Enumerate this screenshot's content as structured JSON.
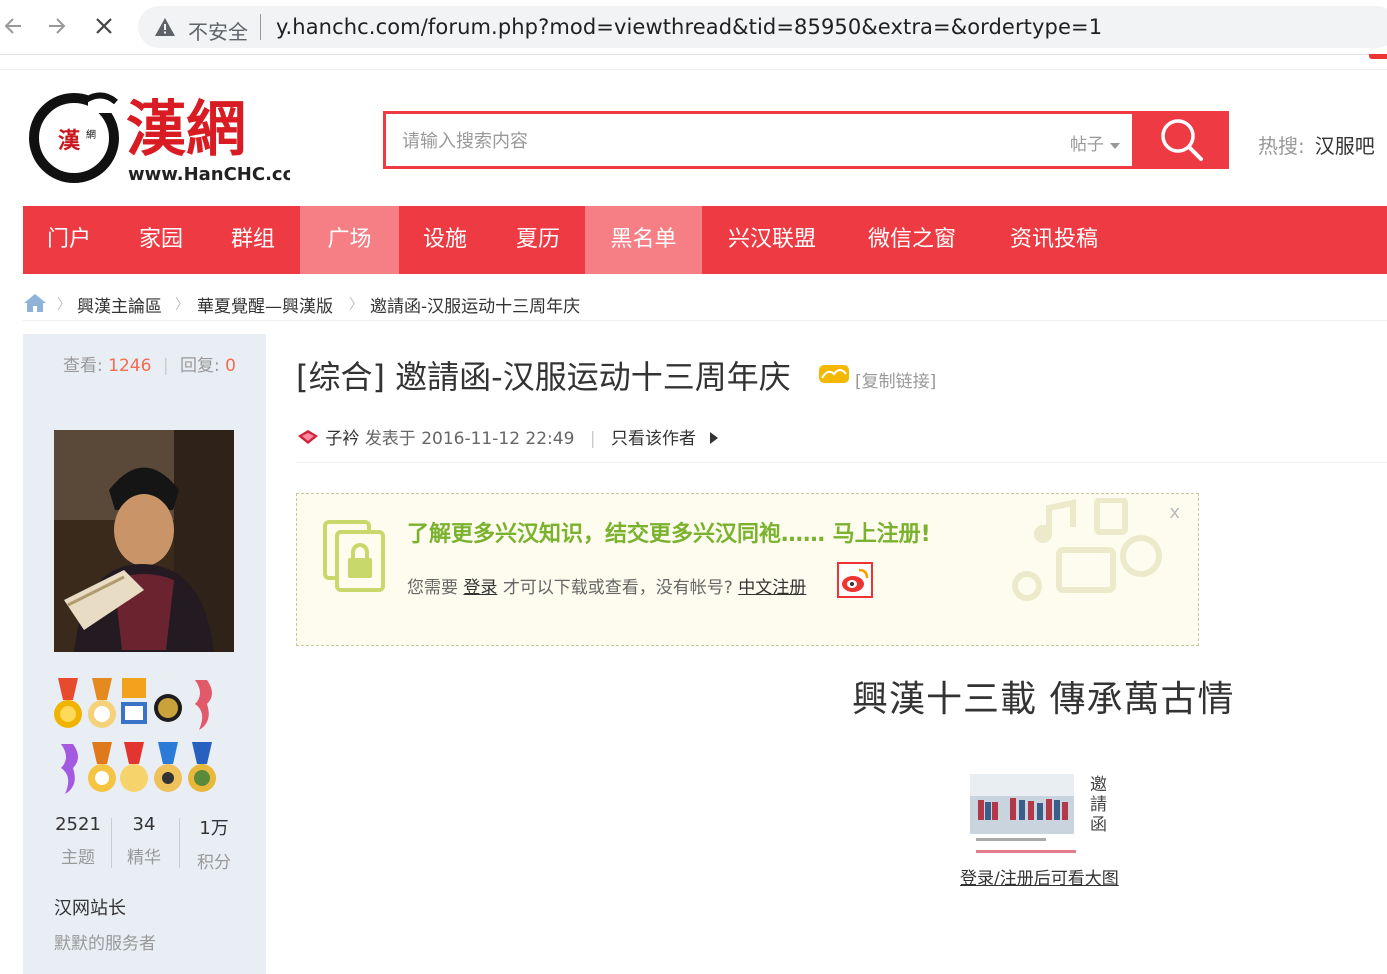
{
  "browser": {
    "insecure_label": "不安全",
    "url": "y.hanchc.com/forum.php?mod=viewthread&tid=85950&extra=&ordertype=1"
  },
  "header": {
    "logo_text_cn": "漢網",
    "logo_text_en": "www.HanCHC.com",
    "search_placeholder": "请输入搜索内容",
    "search_type": "帖子",
    "hot_label": "热搜:",
    "hot_keyword": "汉服吧"
  },
  "nav": [
    {
      "label": "门户"
    },
    {
      "label": "家园"
    },
    {
      "label": "群组"
    },
    {
      "label": "广场"
    },
    {
      "label": "设施"
    },
    {
      "label": "夏历"
    },
    {
      "label": "黑名单"
    },
    {
      "label": "兴汉联盟"
    },
    {
      "label": "微信之窗"
    },
    {
      "label": "资讯投稿"
    }
  ],
  "breadcrumb": [
    "興漢主論區",
    "華夏覺醒—興漢版",
    "邀請函-汉服运动十三周年庆"
  ],
  "sidebar": {
    "views_label": "查看:",
    "views": "1246",
    "replies_label": "回复:",
    "replies": "0",
    "counts": [
      {
        "value": "2521",
        "label": "主题"
      },
      {
        "value": "34",
        "label": "精华"
      },
      {
        "value": "1万",
        "label": "积分"
      }
    ],
    "rank": "汉网站长",
    "motto": "默默的服务者"
  },
  "thread": {
    "title": "[综合] 邀請函-汉服运动十三周年庆",
    "copy_link": "[复制链接]",
    "author": "子衿",
    "posted": "发表于 2016-11-12 22:49",
    "only_author": "只看该作者"
  },
  "notice": {
    "headline": "了解更多兴汉知识，结交更多兴汉同袍…… 马上注册!",
    "text1": "您需要",
    "login": "登录",
    "text2": "才可以下载或查看，没有帐号?",
    "register": "中文注册",
    "close": "x"
  },
  "content": {
    "heading": "興漢十三載  傳承萬古情",
    "thumb_caption": "邀請函",
    "thumb_link": "登录/注册后可看大图"
  },
  "colors": {
    "brand_red": "#ee3a43",
    "nav_active": "#f57f84",
    "notice_green": "#7ab22e",
    "stat_orange": "#f26c4f"
  }
}
